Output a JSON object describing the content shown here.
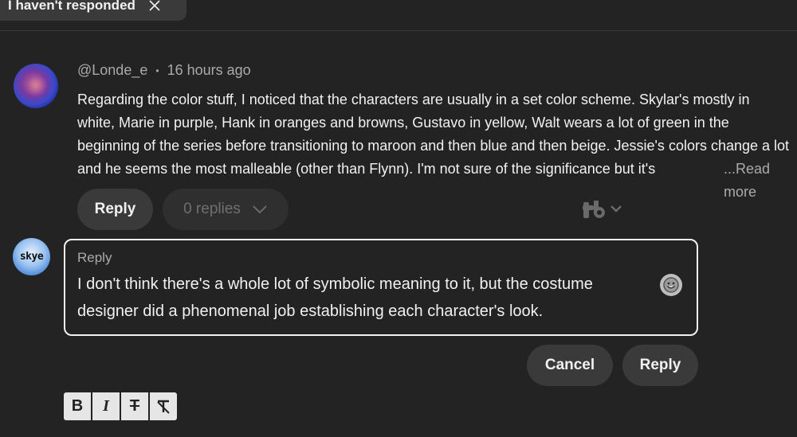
{
  "filter_chip": {
    "label": "I haven't responded"
  },
  "comment": {
    "author": "@Londe_e",
    "separator": "•",
    "time": "16 hours ago",
    "text": "Regarding the color stuff, I noticed that the characters are usually in a set color scheme. Skylar's mostly in white, Marie in purple, Hank in oranges and browns, Gustavo in yellow, Walt wears a lot of green in the beginning of the series before transitioning to maroon and then blue and then beige. Jessie's colors change a lot and he seems the most malleable (other than Flynn). I'm not sure of the significance but it's",
    "read_more": "...Read more",
    "reply_label": "Reply",
    "replies_label": "0 replies"
  },
  "composer": {
    "avatar_text": "skye",
    "label": "Reply",
    "text": "I don't think there's a whole lot of symbolic meaning to it, but the costume designer did a phenomenal job establishing each character's look.",
    "cancel_label": "Cancel",
    "reply_label": "Reply"
  },
  "format_toolbar": {
    "bold": "B",
    "italic": "I",
    "strikethrough": "T",
    "clear": "T"
  },
  "icons": {
    "close": "close-icon",
    "chevron": "chevron-down-icon",
    "emoji": "emoji-icon",
    "tubebuddy": "tubebuddy-icon"
  }
}
